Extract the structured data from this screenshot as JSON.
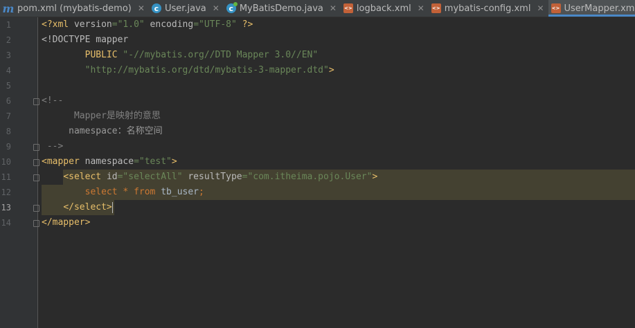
{
  "tabs": [
    {
      "label": "pom.xml (mybatis-demo)",
      "icon": "maven-icon",
      "active": false
    },
    {
      "label": "User.java",
      "icon": "java-class-icon",
      "active": false
    },
    {
      "label": "MyBatisDemo.java",
      "icon": "java-main-class-icon",
      "active": false
    },
    {
      "label": "logback.xml",
      "icon": "xml-file-icon",
      "active": false
    },
    {
      "label": "mybatis-config.xml",
      "icon": "xml-file-icon",
      "active": false
    },
    {
      "label": "UserMapper.xml",
      "icon": "xml-file-icon",
      "active": true
    }
  ],
  "line_numbers": [
    "1",
    "2",
    "3",
    "4",
    "5",
    "6",
    "7",
    "8",
    "9",
    "10",
    "11",
    "12",
    "13",
    "14"
  ],
  "current_line": "13",
  "code": {
    "l1": {
      "a": "<?xml ",
      "b": "version",
      "c": "=",
      "d": "\"1.0\"",
      "e": " encoding",
      "f": "=",
      "g": "\"UTF-8\"",
      "h": " ?>"
    },
    "l2": {
      "a": "<!DOCTYPE mapper"
    },
    "l3": {
      "indent": "        ",
      "a": "PUBLIC ",
      "b": "\"-//mybatis.org//DTD Mapper 3.0//EN\""
    },
    "l4": {
      "indent": "        ",
      "a": "\"http://mybatis.org/dtd/mybatis-3-mapper.dtd\"",
      "b": ">"
    },
    "l6": {
      "a": "<!--"
    },
    "l7": {
      "a": "      Mapper是映射的意思"
    },
    "l8": {
      "a": "     namespace：名称空间"
    },
    "l9": {
      "a": " -->"
    },
    "l10": {
      "a": "<mapper ",
      "b": "namespace",
      "c": "=",
      "d": "\"test\"",
      "e": ">"
    },
    "l11": {
      "indent": "    ",
      "a": "<select ",
      "b": "id",
      "c": "=",
      "d": "\"selectAll\"",
      "e": " resultType",
      "f": "=",
      "g": "\"com.itheima.pojo.User\"",
      "h": ">"
    },
    "l12": {
      "indent": "        ",
      "a": "select",
      "b": " * ",
      "c": "from",
      "d": " tb_user",
      "e": ";"
    },
    "l13": {
      "indent": "    ",
      "a": "</select>"
    },
    "l14": {
      "a": "</mapper>"
    }
  },
  "colors": {
    "background": "#2b2b2b",
    "gutter": "#313335",
    "tag": "#e8bf6a",
    "string": "#6a8759",
    "comment": "#808080",
    "keyword": "#cc7832",
    "highlight": "#444131",
    "active_tab_underline": "#4a88c7"
  }
}
